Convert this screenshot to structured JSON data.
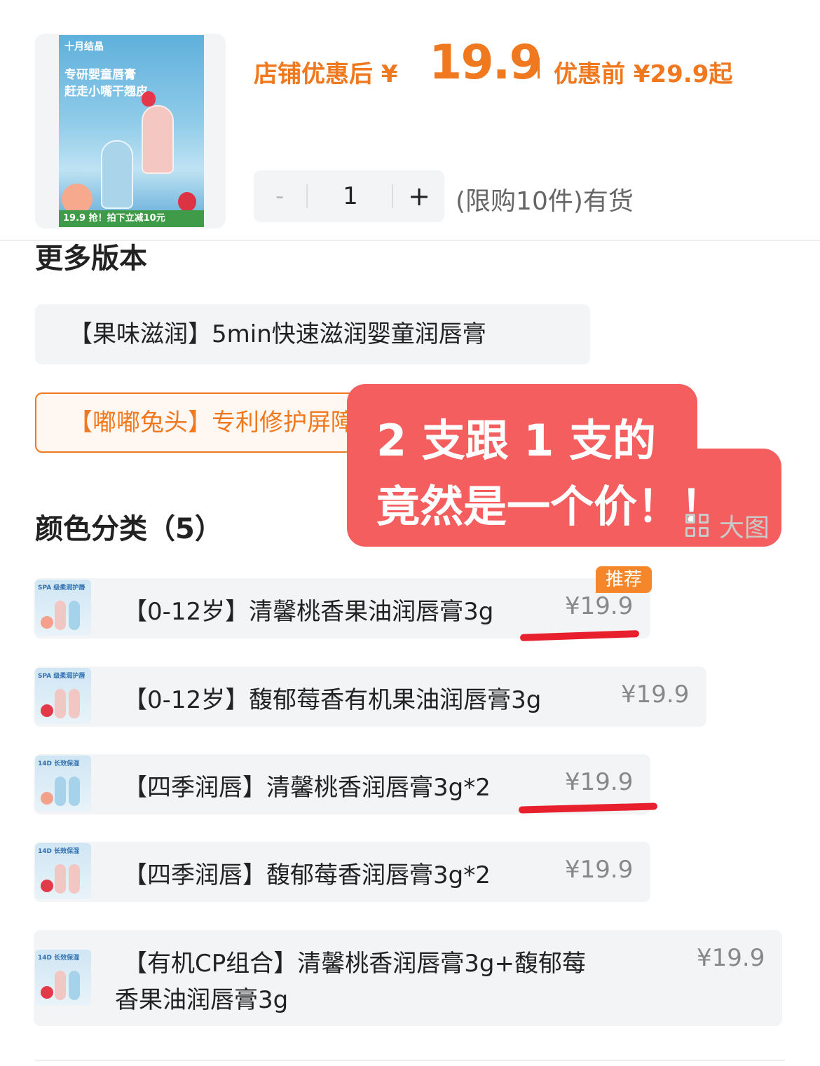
{
  "product": {
    "thumbnail": {
      "brand": "十月结晶",
      "line1": "专研婴童唇膏",
      "line2": "赶走小嘴干翘皮",
      "promo": "19.9 抢！拍下立减10元"
    },
    "price_label": "店铺优惠后 ¥",
    "price_after": "19.9",
    "price_before_text": "优惠前 ¥29.9起",
    "quantity": {
      "minus": "-",
      "value": "1",
      "plus": "+"
    },
    "stock_text": "(限购10件)有货"
  },
  "versions": {
    "title": "更多版本",
    "items": [
      {
        "label": "【果味滋润】5min快速滋润婴童润唇膏",
        "selected": false
      },
      {
        "label": "【嘟嘟兔头】专利修护屏障婴童润唇膏",
        "selected": true
      }
    ]
  },
  "overlay": {
    "line1": "2 支跟 1 支的",
    "line2": "竟然是一个价！！"
  },
  "big_image": {
    "icon": "grid-icon",
    "label": "大图"
  },
  "colors": {
    "title": "颜色分类（5）",
    "recommend_badge": "推荐",
    "items": [
      {
        "label": "【0-12岁】清馨桃香果油润唇膏3g",
        "price": "¥19.9",
        "icon_text": "SPA 级柔润护唇",
        "recommended": true,
        "underlined": true
      },
      {
        "label": "【0-12岁】馥郁莓香有机果油润唇膏3g",
        "price": "¥19.9",
        "icon_text": "SPA 级柔润护唇",
        "recommended": false,
        "underlined": false
      },
      {
        "label": "【四季润唇】清馨桃香润唇膏3g*2",
        "price": "¥19.9",
        "icon_text": "14D 长效保湿",
        "recommended": false,
        "underlined": true
      },
      {
        "label": "【四季润唇】馥郁莓香润唇膏3g*2",
        "price": "¥19.9",
        "icon_text": "14D 长效保湿",
        "recommended": false,
        "underlined": false
      },
      {
        "label_line1": "【有机CP组合】清馨桃香润唇膏3g+馥郁莓",
        "label_line2": "香果油润唇膏3g",
        "price": "¥19.9",
        "icon_text": "14D 长效保湿",
        "recommended": false,
        "underlined": false
      }
    ]
  },
  "colors_palette": {
    "accent": "#f0781e",
    "overlay": "#f45e5e",
    "underline": "#e8202d",
    "chip_bg": "#f3f4f6"
  }
}
